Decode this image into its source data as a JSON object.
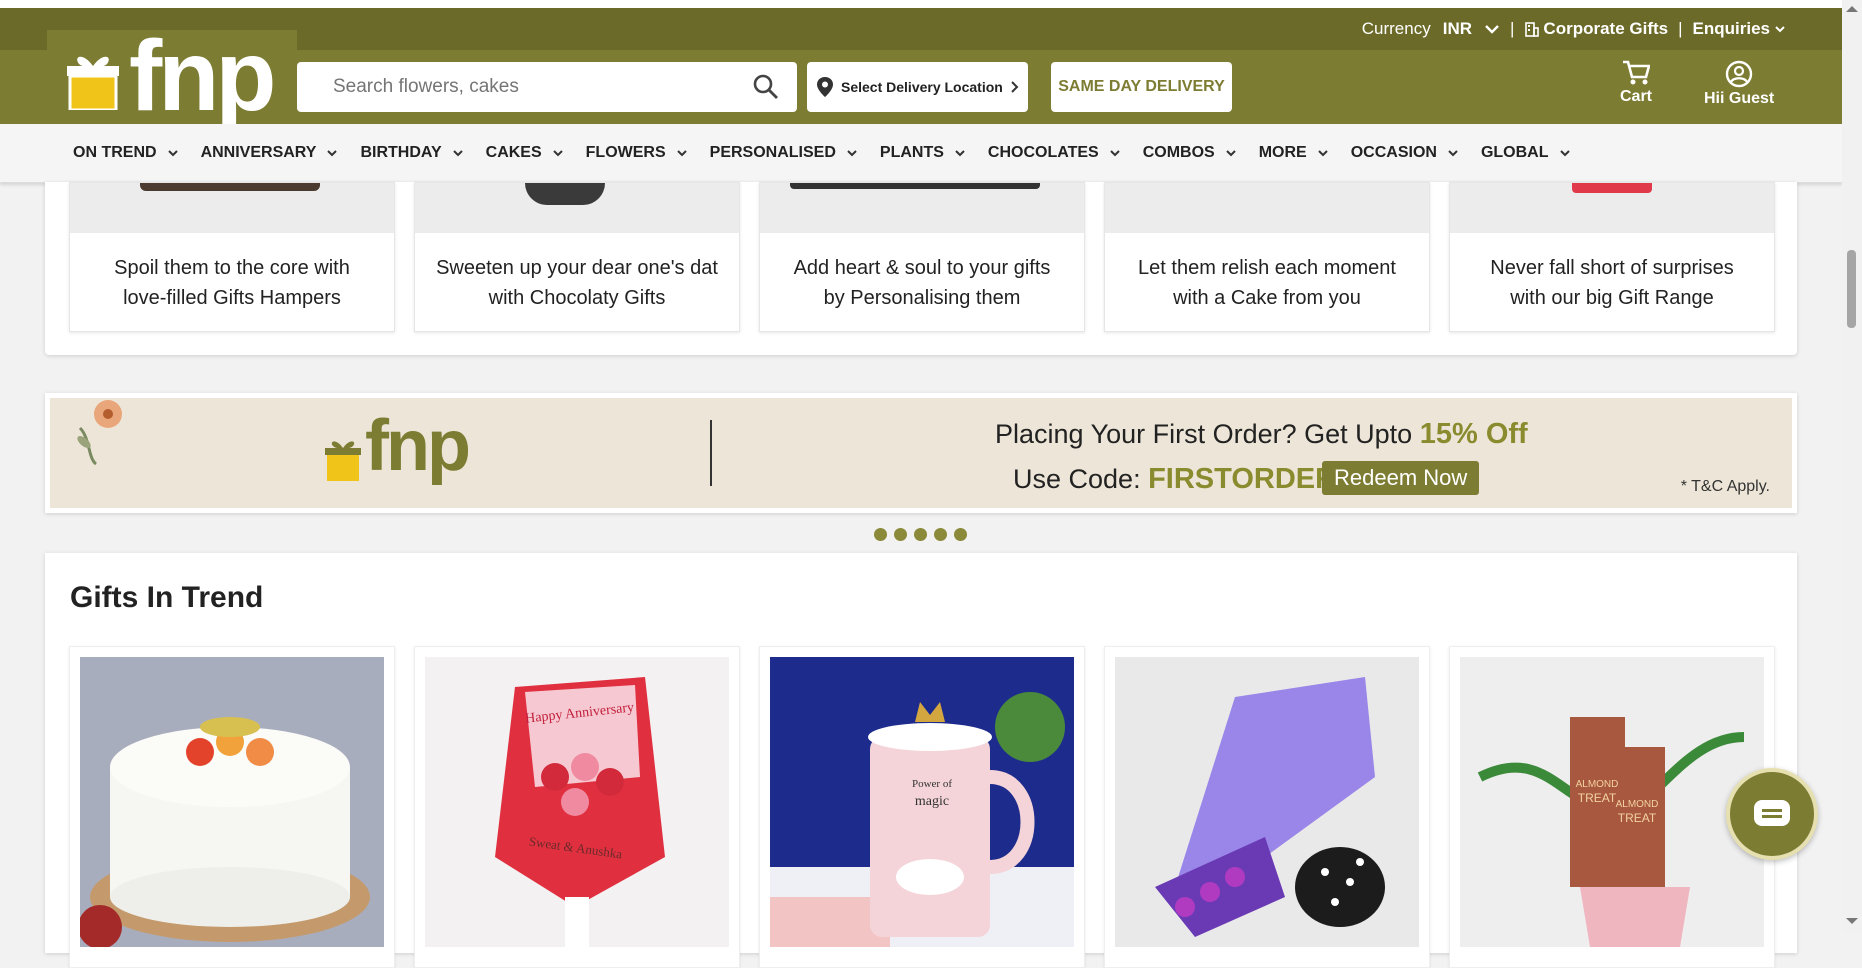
{
  "header": {
    "currency_label": "Currency",
    "currency_value": "INR",
    "divider": "|",
    "corporate_gifts": "Corporate Gifts",
    "enquiries": "Enquiries",
    "logo_text": "fnp",
    "search_placeholder": "Search flowers, cakes",
    "delivery_location": "Select Delivery Location",
    "same_day_delivery": "SAME DAY DELIVERY",
    "cart_label": "Cart",
    "account_label": "Hii Guest",
    "brand_color": "#7d7c33"
  },
  "nav": {
    "items": [
      "ON TREND",
      "ANNIVERSARY",
      "BIRTHDAY",
      "CAKES",
      "FLOWERS",
      "PERSONALISED",
      "PLANTS",
      "CHOCOLATES",
      "COMBOS",
      "MORE",
      "OCCASION",
      "GLOBAL"
    ]
  },
  "categories": [
    {
      "line1": "Spoil them to the core with",
      "line2": "love-filled Gifts Hampers"
    },
    {
      "line1": "Sweeten up your dear one's dat",
      "line2": "with Chocolaty Gifts"
    },
    {
      "line1": "Add heart & soul to your gifts",
      "line2": "by Personalising them"
    },
    {
      "line1": "Let them relish each moment",
      "line2": "with a Cake from you"
    },
    {
      "line1": "Never fall short of surprises",
      "line2": "with our big Gift Range"
    }
  ],
  "banner": {
    "logo_text": "fnp",
    "line1_prefix": "Placing Your First Order? Get Upto",
    "line1_offer": "15% Off",
    "line2_prefix": "Use Code:",
    "code": "FIRSTORDER",
    "cta": "Redeem Now",
    "terms": "* T&C Apply."
  },
  "gifts_in_trend": {
    "title": "Gifts In Trend",
    "images": [
      {
        "label_lines": []
      },
      {
        "label_lines": [
          "Happy Anniversary",
          "Sweat & Anushka"
        ]
      },
      {
        "label_lines": [
          "Power of",
          "magic"
        ]
      },
      {
        "label_lines": []
      },
      {
        "label_lines": [
          "ALMOND",
          "TREAT",
          "ALMOND",
          "TREAT"
        ]
      }
    ]
  }
}
